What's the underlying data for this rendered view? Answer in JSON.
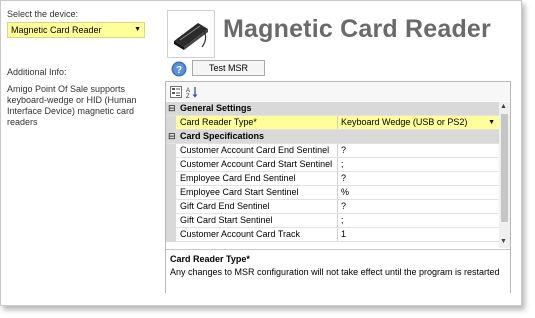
{
  "left": {
    "select_label": "Select the device:",
    "selected_device": "Magnetic Card Reader",
    "info_label": "Additional Info:",
    "info_text": "Amigo Point Of Sale supports keyboard-wedge or HID (Human Interface Device) magnetic card readers"
  },
  "header": {
    "title": "Magnetic Card Reader",
    "icon": "card-reader-icon"
  },
  "toolbar": {
    "test_button": "Test MSR"
  },
  "grid": {
    "cat1": "General Settings",
    "card_reader_type_label": "Card Reader Type*",
    "card_reader_type_value": "Keyboard Wedge (USB or PS2)",
    "cat2": "Card Specifications",
    "rows": [
      {
        "name": "Customer Account Card End Sentinel",
        "value": "?"
      },
      {
        "name": "Customer Account Card Start Sentinel",
        "value": ";"
      },
      {
        "name": "Employee Card End Sentinel",
        "value": "?"
      },
      {
        "name": "Employee Card Start Sentinel",
        "value": "%"
      },
      {
        "name": "Gift Card End Sentinel",
        "value": "?"
      },
      {
        "name": "Gift Card Start Sentinel",
        "value": ";"
      },
      {
        "name": "Customer Account Card Track",
        "value": "1"
      }
    ]
  },
  "description": {
    "title": "Card Reader Type*",
    "text": "Any changes to MSR configuration will not take effect until the program is restarted"
  },
  "colors": {
    "highlight": "#ffff99",
    "category_bg": "#d9d9d9",
    "title_color": "#6a6a6a"
  }
}
